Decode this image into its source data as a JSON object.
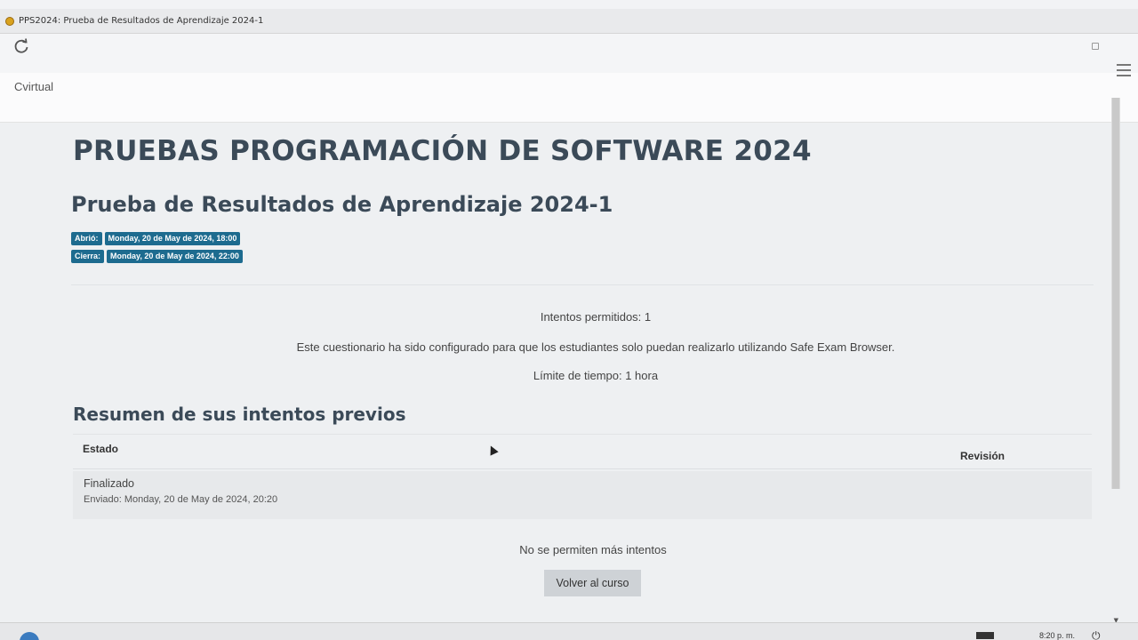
{
  "window": {
    "title": "PPS2024: Prueba de Resultados de Aprendizaje 2024-1"
  },
  "toolbar": {
    "reload_icon": "reload-icon"
  },
  "navbar": {
    "brand": "Cvirtual",
    "menu_icon": "hamburger-menu-icon"
  },
  "course": {
    "title": "PRUEBAS PROGRAMACIÓN DE SOFTWARE 2024"
  },
  "quiz": {
    "title": "Prueba de Resultados de Aprendizaje 2024-1",
    "dates": [
      {
        "label": "Abrió:",
        "value": "Monday, 20 de May de 2024, 18:00"
      },
      {
        "label": "Cierra:",
        "value": "Monday, 20 de May de 2024, 22:00"
      }
    ],
    "info": {
      "attempts": "Intentos permitidos: 1",
      "seb_notice": "Este cuestionario ha sido configurado para que los estudiantes solo puedan realizarlo utilizando Safe Exam Browser.",
      "time_limit": "Límite de tiempo: 1 hora"
    }
  },
  "summary": {
    "heading": "Resumen de sus intentos previos",
    "columns": [
      "Estado",
      "Revisión"
    ],
    "rows": [
      {
        "state": "Finalizado",
        "sent": "Enviado: Monday, 20 de May de 2024, 20:20"
      }
    ],
    "no_more": "No se permiten más intentos",
    "back_button": "Volver al curso"
  },
  "taskbar": {
    "time": "8:20 p. m."
  },
  "colors": {
    "badge": "#1d6b8f",
    "heading": "#3b4a58",
    "button": "#ced2d6"
  }
}
